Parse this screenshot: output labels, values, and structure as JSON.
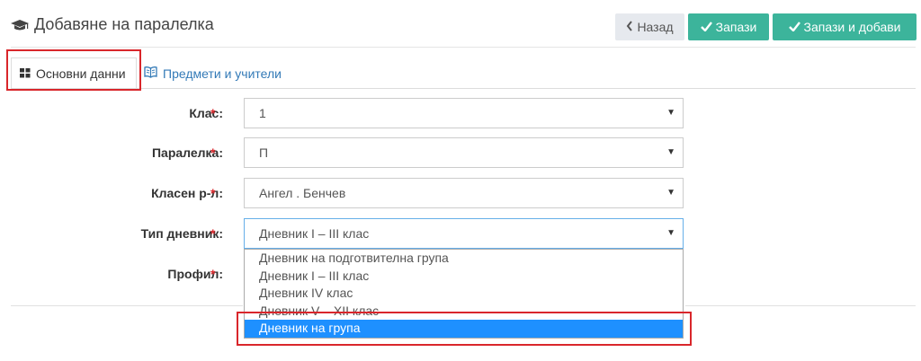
{
  "header": {
    "title": "Добавяне на паралелка",
    "buttons": {
      "back": "Назад",
      "save": "Запази",
      "save_add": "Запази и добави"
    }
  },
  "tabs": [
    {
      "label": "Основни данни",
      "icon": "grid-icon",
      "active": true
    },
    {
      "label": "Предмети и учители",
      "icon": "book-icon",
      "active": false
    }
  ],
  "form": {
    "required_mark": "*",
    "fields": [
      {
        "label": "Клас:",
        "value": "1"
      },
      {
        "label": "Паралелка:",
        "value": "П"
      },
      {
        "label": "Класен р-л:",
        "value": "Ангел . Бенчев"
      },
      {
        "label": "Тип дневник:",
        "value": "Дневник I – III клас"
      },
      {
        "label": "Профил:",
        "value": ""
      }
    ]
  },
  "dropdown": {
    "options": [
      "Дневник на подготвителна група",
      "Дневник I – III клас",
      "Дневник IV клас",
      "Дневник V – XII клас",
      "Дневник на група"
    ],
    "highlighted": "Дневник на група"
  },
  "colors": {
    "accent": "#3cb49b",
    "highlight_box": "#d9262b",
    "selected_option": "#1e90ff",
    "link": "#337ab7"
  }
}
